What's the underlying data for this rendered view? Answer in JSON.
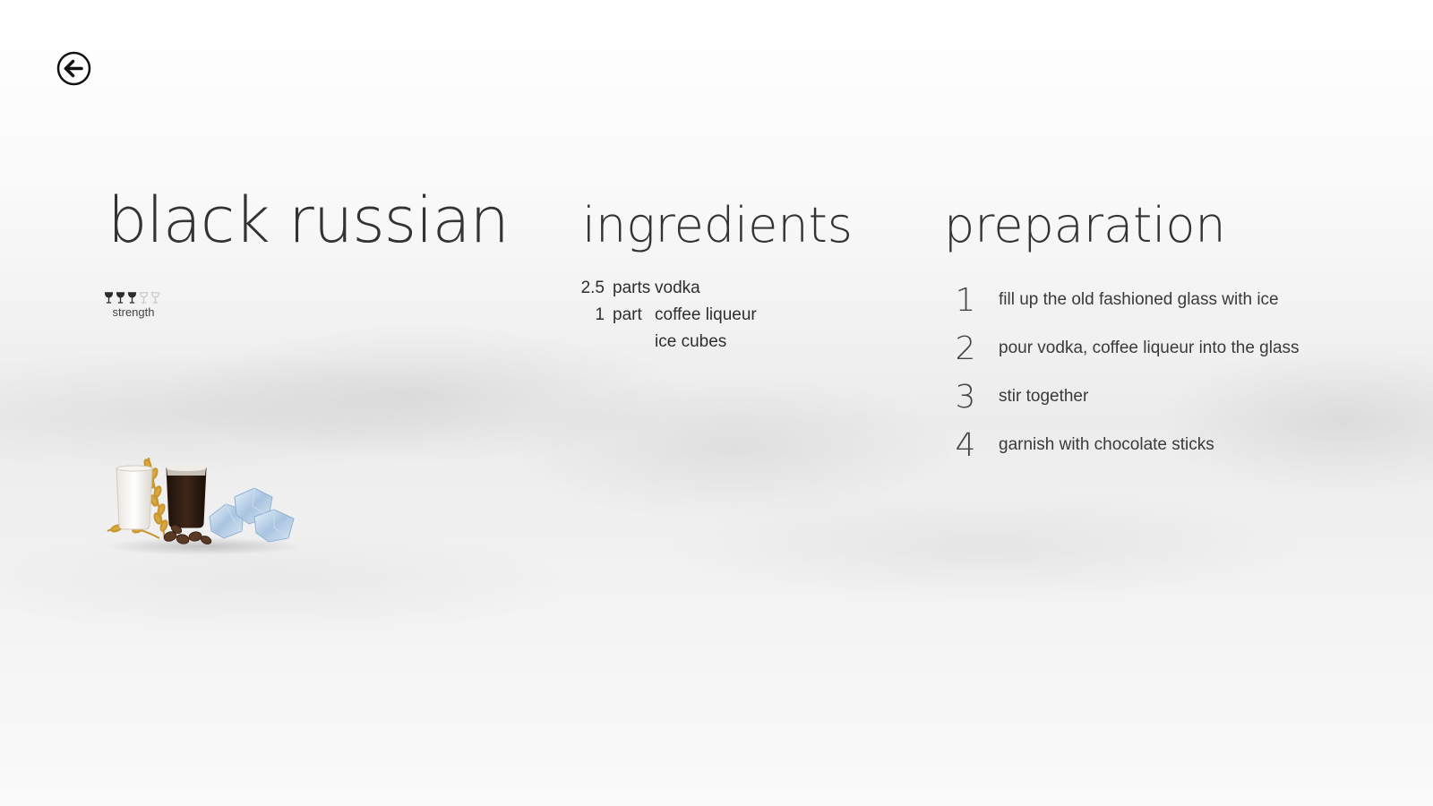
{
  "drink": {
    "title": "black russian",
    "strength": {
      "label": "strength",
      "level": 3,
      "max": 5
    }
  },
  "ingredients": {
    "heading": "ingredients",
    "items": [
      {
        "amount": "2.5",
        "unit": "parts",
        "name": "vodka"
      },
      {
        "amount": "1",
        "unit": "part",
        "name": "coffee liqueur"
      },
      {
        "amount": "",
        "unit": "",
        "name": "ice cubes"
      }
    ]
  },
  "preparation": {
    "heading": "preparation",
    "steps": [
      {
        "number": "1",
        "text": "fill up the old fashioned glass with ice"
      },
      {
        "number": "2",
        "text": "pour vodka, coffee liqueur into the glass"
      },
      {
        "number": "3",
        "text": "stir together"
      },
      {
        "number": "4",
        "text": "garnish with chocolate sticks"
      }
    ]
  },
  "icons": {
    "back": "back-arrow-icon",
    "strength_glass": "wine-glass-icon",
    "drink_image": "drink-ingredients-image"
  },
  "colors": {
    "text": "#2a2a2a",
    "glass_filled": "#2b2b2b",
    "glass_empty": "#c8c8c8",
    "coffee": "#2f1d12"
  }
}
